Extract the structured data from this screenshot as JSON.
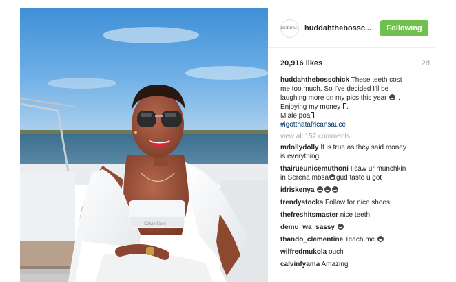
{
  "header": {
    "avatar_text": "HUDDAH",
    "username": "huddahthebossc...",
    "follow_label": "Following"
  },
  "stats": {
    "likes": "20,916 likes",
    "time": "2d"
  },
  "caption": {
    "username": "huddahthebosschick",
    "line1": "These teeth cost",
    "line2": "me too much. So I've decided I'll be",
    "line3": "laughing more on my pics this year",
    "line3_end": ".",
    "line4": "Enjoying my money",
    "line4_end": ".",
    "line5": "Mlale poa",
    "hashtag": "#igotthatafricansauce"
  },
  "view_all": "view all 152 comments",
  "comments": [
    {
      "user": "mdollydolly",
      "text": "It is true as they said money",
      "text2": "is everything"
    },
    {
      "user": "thairueunicemuthoni",
      "text": "I saw ur munchkin",
      "text2": "in Serena mbsa",
      "text2b": "gud taste u got"
    },
    {
      "user": "idriskenya",
      "text": ""
    },
    {
      "user": "trendystocks",
      "text": "Follow for nice shoes"
    },
    {
      "user": "thefreshitsmaster",
      "text": "nice teeth."
    },
    {
      "user": "demu_wa_sassy",
      "text": ""
    },
    {
      "user": "thando_clementine",
      "text": "Teach me"
    },
    {
      "user": "wilfredmukola",
      "text": "ouch"
    },
    {
      "user": "calvinfyama",
      "text": "Amazing"
    }
  ],
  "photo": {
    "bra_text": "Calvin Klein"
  },
  "colors": {
    "follow_green": "#70c050",
    "hashtag_blue": "#003569",
    "muted_gray": "#a5a7aa"
  }
}
